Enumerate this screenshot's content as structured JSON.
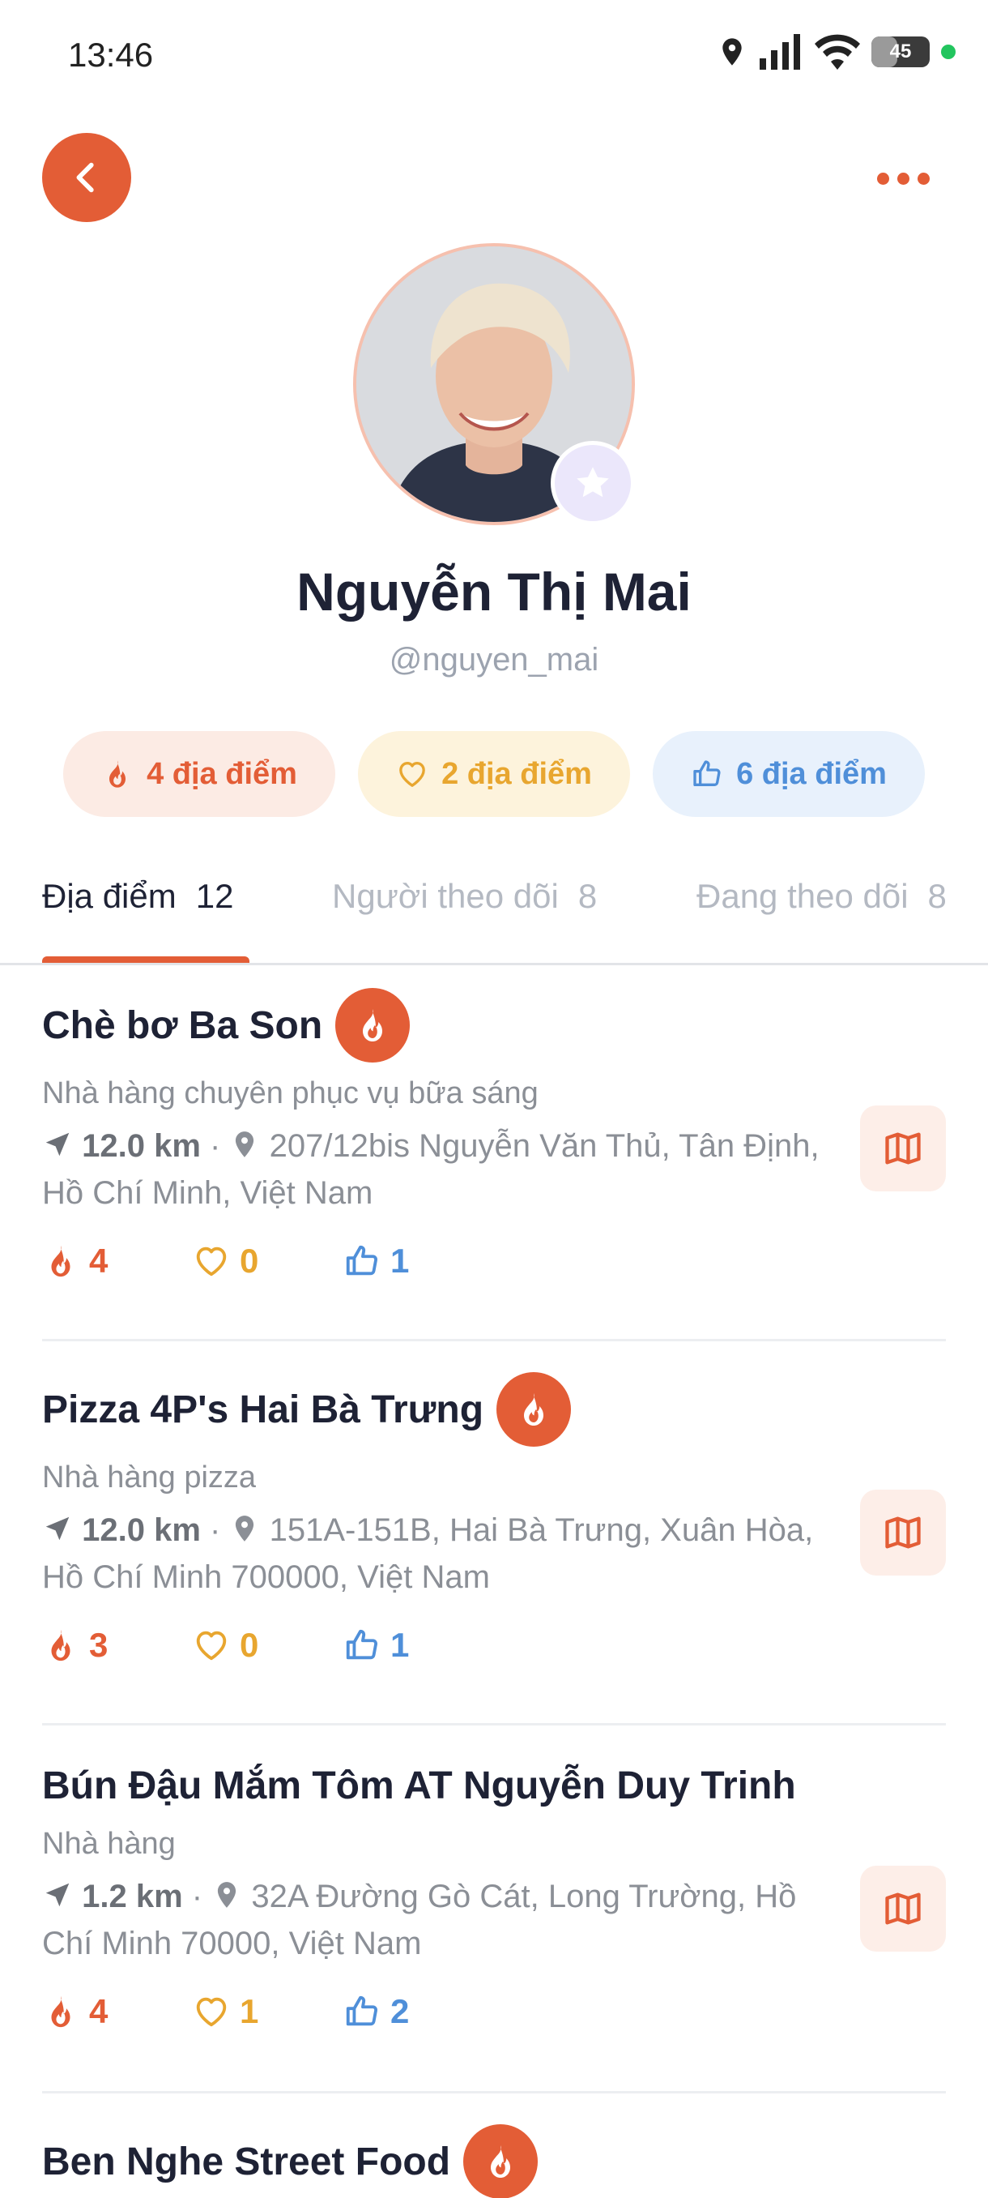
{
  "status_bar": {
    "time": "13:46",
    "battery": "45",
    "battery_fraction": 0.45
  },
  "colors": {
    "accent": "#e35d36",
    "heart": "#e8a62f",
    "like": "#4f8fd9",
    "text_dark": "#1e2235",
    "text_muted": "#8b8f96"
  },
  "profile": {
    "name": "Nguyễn Thị Mai",
    "handle": "@nguyen_mai",
    "stats": {
      "fire": "4 địa điểm",
      "heart": "2 địa điểm",
      "like": "6 địa điểm"
    }
  },
  "tabs": [
    {
      "label": "Địa điểm",
      "count": "12",
      "active": true
    },
    {
      "label": "Người theo dõi",
      "count": "8",
      "active": false
    },
    {
      "label": "Đang theo dõi",
      "count": "8",
      "active": false
    }
  ],
  "places": [
    {
      "name": "Chè bơ Ba Son",
      "hot": true,
      "category": "Nhà hàng chuyên phục vụ bữa sáng",
      "distance": "12.0 km",
      "address": "207/12bis Nguyễn Văn Thủ, Tân Định, Hồ Chí Minh, Việt Nam",
      "fire": "4",
      "heart": "0",
      "like": "1"
    },
    {
      "name": "Pizza 4P's Hai Bà Trưng",
      "hot": true,
      "category": "Nhà hàng pizza",
      "distance": "12.0 km",
      "address": "151A-151B, Hai Bà Trưng, Xuân Hòa, Hồ Chí Minh 700000, Việt Nam",
      "fire": "3",
      "heart": "0",
      "like": "1"
    },
    {
      "name": "Bún Đậu Mắm Tôm AT Nguyễn Duy Trinh",
      "hot": false,
      "category": "Nhà hàng",
      "distance": "1.2 km",
      "address": "32A Đường Gò Cát, Long Trường, Hồ Chí Minh 70000, Việt Nam",
      "fire": "4",
      "heart": "1",
      "like": "2"
    },
    {
      "name": "Ben Nghe Street Food",
      "hot": true
    }
  ],
  "icons": {
    "back": "chevron-left-icon",
    "more": "more-horizontal-icon",
    "fire": "fire-icon",
    "heart": "heart-icon",
    "like": "thumbs-up-icon",
    "navigate": "navigation-arrow-icon",
    "pin": "map-pin-icon",
    "map": "map-icon",
    "star": "star-icon"
  }
}
